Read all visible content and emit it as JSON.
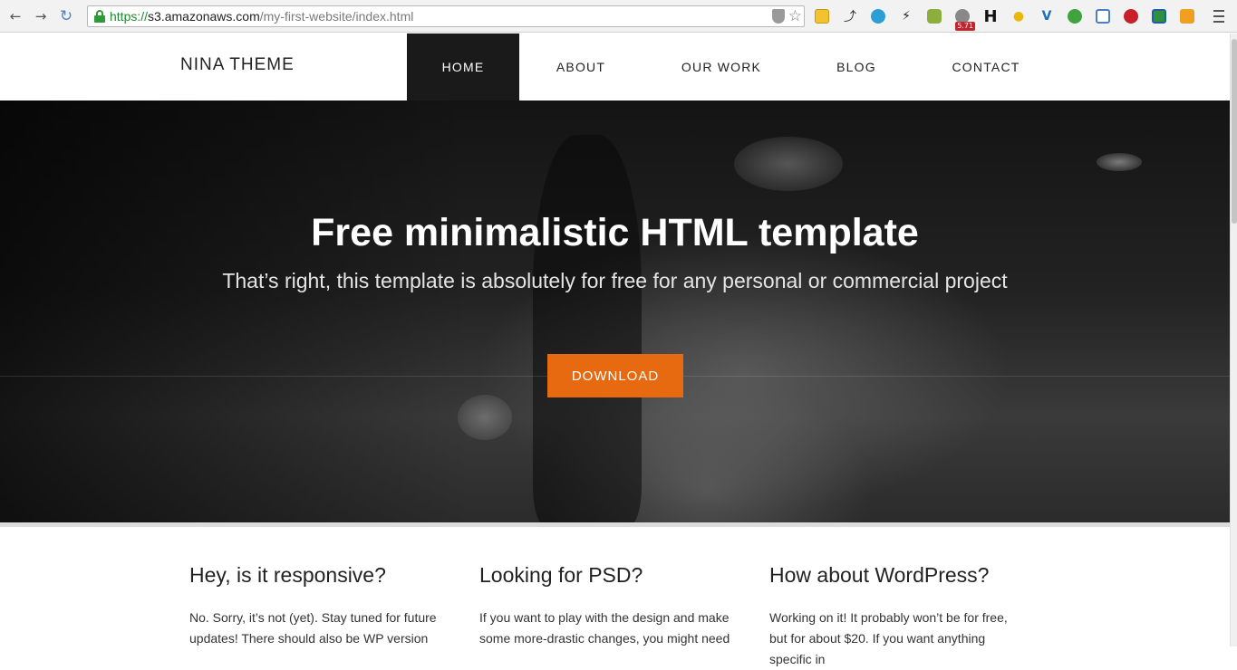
{
  "browser": {
    "url_scheme": "https://",
    "url_host": "s3.amazonaws.com",
    "url_path": "/my-first-website/index.html",
    "extension_badge": "5.71"
  },
  "site": {
    "logo": "NINA THEME",
    "menu": [
      {
        "label": "HOME",
        "active": true
      },
      {
        "label": "ABOUT",
        "active": false
      },
      {
        "label": "OUR WORK",
        "active": false
      },
      {
        "label": "BLOG",
        "active": false
      },
      {
        "label": "CONTACT",
        "active": false
      }
    ]
  },
  "hero": {
    "title": "Free minimalistic HTML template",
    "subtitle": "That’s right, this template is absolutely for free for any personal or commercial project",
    "button": "DOWNLOAD"
  },
  "features": [
    {
      "title": "Hey, is it responsive?",
      "text": "No. Sorry, it’s not (yet). Stay tuned for future updates! There should also be WP version"
    },
    {
      "title": "Looking for PSD?",
      "text": "If you want to play with the design and make some more-drastic changes, you might need"
    },
    {
      "title": "How about WordPress?",
      "text": "Working on it! It probably won’t be for free, but for about $20. If you want anything specific in"
    }
  ],
  "colors": {
    "accent": "#e86a10",
    "active_menu_bg": "#1a1a1a"
  }
}
